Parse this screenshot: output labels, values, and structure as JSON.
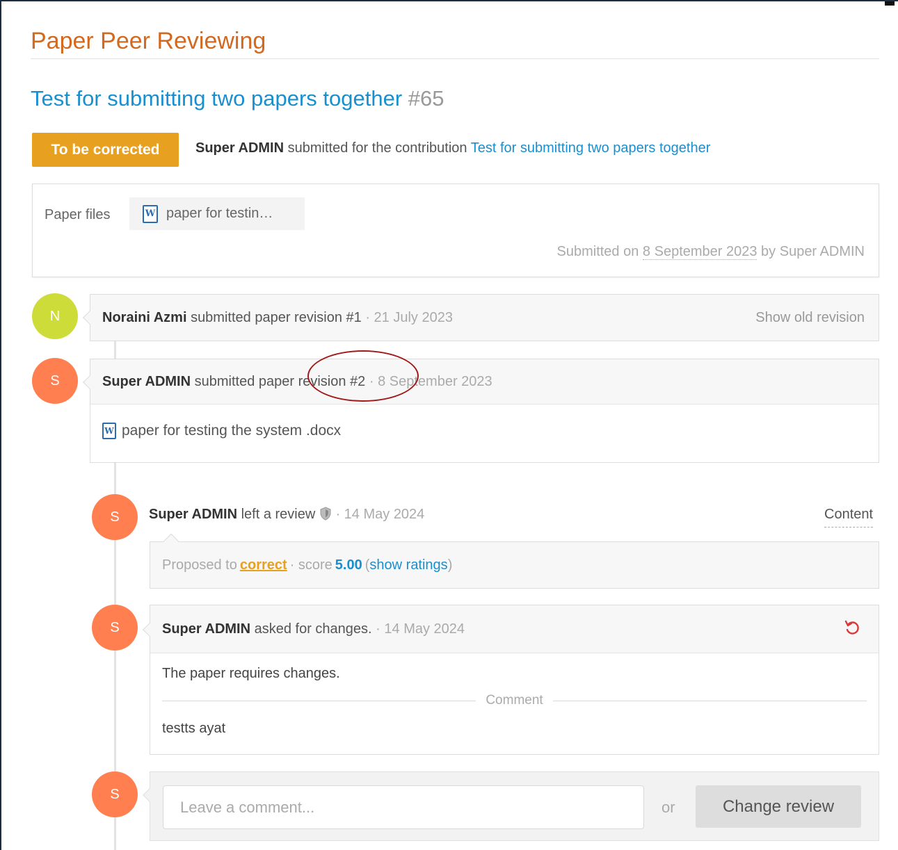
{
  "page": {
    "title": "Paper Peer Reviewing"
  },
  "contribution": {
    "title": "Test for submitting two papers together",
    "number": "#65",
    "status_badge": "To be corrected",
    "submitter": "Super ADMIN",
    "submitted_text": "submitted for the contribution",
    "link_text": "Test for submitting two papers together"
  },
  "files_box": {
    "label": "Paper files",
    "file_name": "paper for testin…",
    "meta_prefix": "Submitted on",
    "meta_date": "8 September 2023",
    "meta_by": "by Super ADMIN"
  },
  "timeline": {
    "rev1": {
      "avatar": "N",
      "author": "Noraini Azmi",
      "action": "submitted paper revision #1",
      "date": "· 21 July 2023",
      "right_link": "Show old revision"
    },
    "rev2": {
      "avatar": "S",
      "author": "Super ADMIN",
      "action": "submitted paper revision #2",
      "date": "· 8 September 2023",
      "file": "paper for testing the system .docx"
    },
    "review": {
      "avatar": "S",
      "author": "Super ADMIN",
      "action": "left a review",
      "date": "· 14 May 2024",
      "tab": "Content",
      "proposed_prefix": "Proposed to",
      "proposed_value": "correct",
      "score_prefix": "· score",
      "score": "5.00",
      "ratings_link": "show ratings"
    },
    "changes": {
      "avatar": "S",
      "author": "Super ADMIN",
      "action": "asked for changes.",
      "date": "· 14 May 2024",
      "body": "The paper requires changes.",
      "comment_label": "Comment",
      "comment": "testts ayat"
    },
    "comment_form": {
      "avatar": "S",
      "placeholder": "Leave a comment...",
      "or": "or",
      "button": "Change review"
    }
  },
  "colors": {
    "accent": "#d2691e",
    "link": "#1a8fcf",
    "badge": "#e8a020",
    "annotation": "#a01818"
  }
}
